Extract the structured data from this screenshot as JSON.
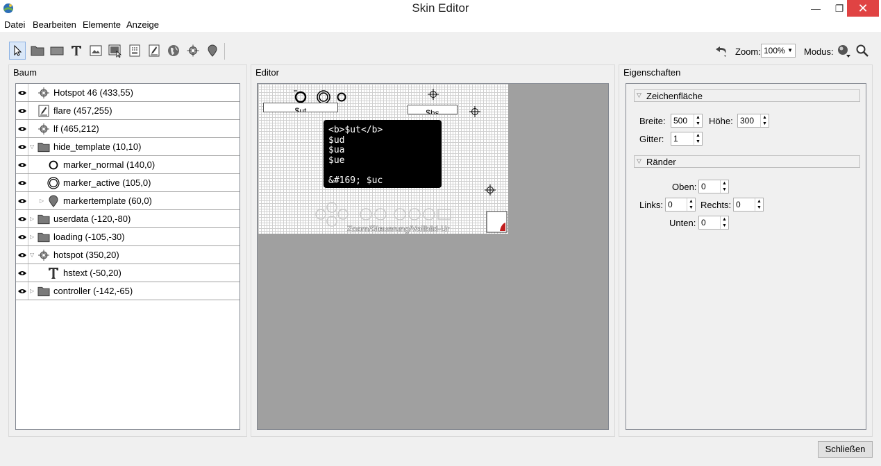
{
  "window": {
    "title": "Skin Editor",
    "minimize": "—",
    "maximize": "❐",
    "close": "✕"
  },
  "menu": [
    "Datei",
    "Bearbeiten",
    "Elemente",
    "Anzeige"
  ],
  "toolbar": {
    "tools": [
      "pointer-tool",
      "folder-tool",
      "rectangle-tool",
      "text-tool",
      "image-tool",
      "button-tool",
      "grid-tool",
      "flare-tool",
      "map-tool",
      "hotspot-tool",
      "marker-tool"
    ],
    "zoom_label": "Zoom:",
    "zoom_value": "100%",
    "modus_label": "Modus:"
  },
  "panels": {
    "tree": "Baum",
    "editor": "Editor",
    "properties": "Eigenschaften"
  },
  "tree": [
    {
      "label": "Hotspot 46 (433,55)",
      "icon": "hotspot-icon",
      "indent": 0,
      "expander": ""
    },
    {
      "label": "flare (457,255)",
      "icon": "flare-icon",
      "indent": 0,
      "expander": ""
    },
    {
      "label": "lf (465,212)",
      "icon": "hotspot-icon",
      "indent": 0,
      "expander": ""
    },
    {
      "label": "hide_template (10,10)",
      "icon": "folder-icon",
      "indent": 0,
      "expander": "open"
    },
    {
      "label": "marker_normal (140,0)",
      "icon": "circle-icon",
      "indent": 1,
      "expander": ""
    },
    {
      "label": "marker_active (105,0)",
      "icon": "double-circle-icon",
      "indent": 1,
      "expander": ""
    },
    {
      "label": "markertemplate (60,0)",
      "icon": "marker-icon",
      "indent": 1,
      "expander": "closed"
    },
    {
      "label": "userdata (-120,-80)",
      "icon": "folder-icon",
      "indent": 0,
      "expander": "closed"
    },
    {
      "label": "loading (-105,-30)",
      "icon": "folder-icon",
      "indent": 0,
      "expander": "closed"
    },
    {
      "label": "hotspot (350,20)",
      "icon": "hotspot-icon",
      "indent": 0,
      "expander": "open"
    },
    {
      "label": "hstext (-50,20)",
      "icon": "text-icon",
      "indent": 1,
      "expander": ""
    },
    {
      "label": "controller (-142,-65)",
      "icon": "folder-icon",
      "indent": 0,
      "expander": "closed"
    }
  ],
  "canvas": {
    "field_ut": "$ut",
    "field_hs": "$hs",
    "tooltip_lines": [
      "<b>$ut</b>",
      "$ud",
      "$ua",
      "$ue",
      "",
      "&#169; $uc"
    ],
    "controller_text": "Zoom/Steuerung/Vollbild-Ur"
  },
  "properties": {
    "section_canvas": "Zeichenfläche",
    "breite_label": "Breite:",
    "breite_value": "500",
    "hoehe_label": "Höhe:",
    "hoehe_value": "300",
    "gitter_label": "Gitter:",
    "gitter_value": "1",
    "section_borders": "Ränder",
    "oben_label": "Oben:",
    "oben_value": "0",
    "links_label": "Links:",
    "links_value": "0",
    "rechts_label": "Rechts:",
    "rechts_value": "0",
    "unten_label": "Unten:",
    "unten_value": "0"
  },
  "footer": {
    "close_label": "Schließen"
  }
}
